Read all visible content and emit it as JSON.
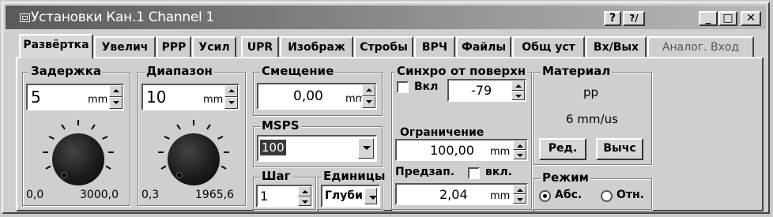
{
  "window": {
    "title": "Установки Кан.1 Channel 1",
    "help_label": "?",
    "context_help_label": "?/",
    "minimize_label": "_",
    "maximize_label": "□",
    "close_label": "✕"
  },
  "tabs": [
    {
      "label": "Развёртка",
      "active": true
    },
    {
      "label": "Увелич"
    },
    {
      "label": "РРР"
    },
    {
      "label": "Усил"
    },
    {
      "label": "UPR"
    },
    {
      "label": "Изображ"
    },
    {
      "label": "Стробы"
    },
    {
      "label": "ВРЧ"
    },
    {
      "label": "Файлы"
    },
    {
      "label": "Общ уст"
    },
    {
      "label": "Вх/Вых"
    },
    {
      "label": "Аналог. Вход",
      "disabled": true
    }
  ],
  "delay": {
    "label": "Задержка",
    "value": "5",
    "unit": "mm",
    "min_label": "0,0",
    "max_label": "3000,0"
  },
  "range": {
    "label": "Диапазон",
    "value": "10",
    "unit": "mm",
    "min_label": "0,3",
    "max_label": "1965,6"
  },
  "offset": {
    "label": "Смещение",
    "value": "0,00",
    "unit": "mm"
  },
  "msps": {
    "label": "MSPS",
    "value": "100"
  },
  "step": {
    "label": "Шаг",
    "value": "1"
  },
  "units": {
    "label": "Единицы",
    "value": "Глуби"
  },
  "sync": {
    "label": "Синхро от поверхн",
    "enable_label": "Вкл",
    "value": "-79",
    "limit_label": "Ограничение",
    "limit_value": "100,00",
    "limit_unit": "mm",
    "pretrigger_label": "Предзап.",
    "pretrigger_enable_label": "вкл.",
    "pretrigger_value": "2,04",
    "pretrigger_unit": "mm"
  },
  "material": {
    "label": "Материал",
    "name": "pp",
    "velocity": "6 mm/us",
    "edit_label": "Ред.",
    "calc_label": "Вычс"
  },
  "mode": {
    "label": "Режим",
    "abs_label": "Абс.",
    "rel_label": "Отн.",
    "selected": "abs"
  }
}
